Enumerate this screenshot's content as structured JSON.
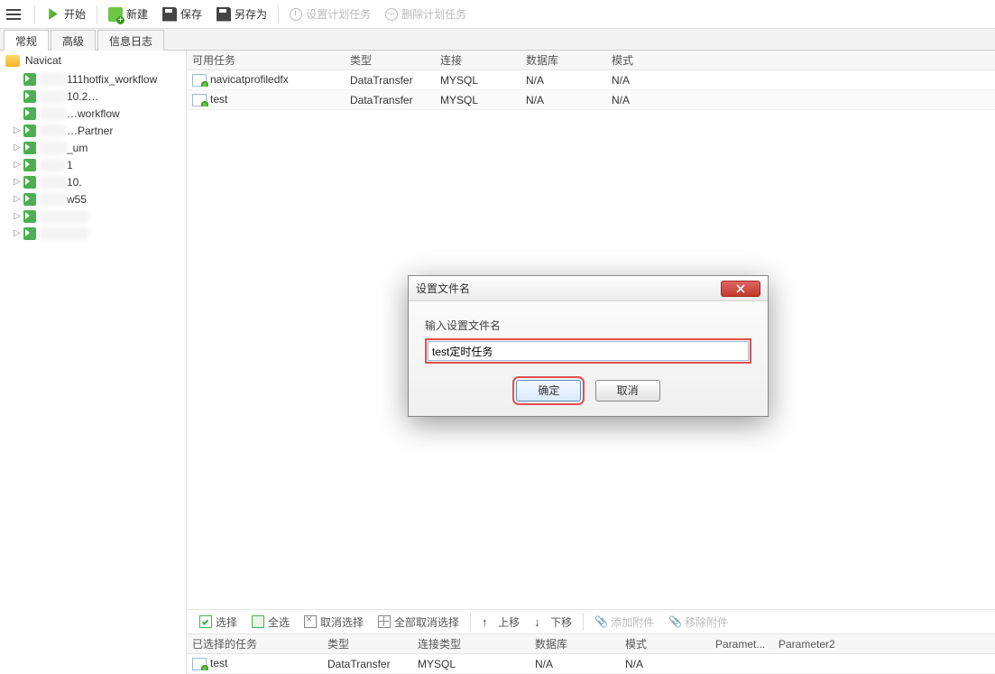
{
  "toolbar": {
    "start": "开始",
    "new": "新建",
    "save": "保存",
    "save_as": "另存为",
    "set_schedule": "设置计划任务",
    "delete_schedule": "删除计划任务"
  },
  "tabs": {
    "general": "常规",
    "advanced": "高级",
    "log": "信息日志"
  },
  "sidebar": {
    "root": "Navicat",
    "items": [
      {
        "label": "111hotfix_workflow"
      },
      {
        "label": "10.2…"
      },
      {
        "label": "…workflow"
      },
      {
        "label": "…Partner"
      },
      {
        "label": "_um"
      },
      {
        "label": "1"
      },
      {
        "label": "10."
      },
      {
        "label": "w55"
      },
      {
        "label": ""
      },
      {
        "label": ""
      }
    ]
  },
  "available": {
    "columns": {
      "task": "可用任务",
      "type": "类型",
      "conn": "连接",
      "db": "数据库",
      "mode": "模式"
    },
    "rows": [
      {
        "task": "navicatprofiledfx",
        "type": "DataTransfer",
        "conn": "MYSQL",
        "db": "N/A",
        "mode": "N/A"
      },
      {
        "task": "test",
        "type": "DataTransfer",
        "conn": "MYSQL",
        "db": "N/A",
        "mode": "N/A"
      }
    ]
  },
  "actions": {
    "select": "选择",
    "select_all": "全选",
    "deselect": "取消选择",
    "deselect_all": "全部取消选择",
    "move_up": "上移",
    "move_down": "下移",
    "add_attach": "添加附件",
    "remove_attach": "移除附件"
  },
  "selected": {
    "columns": {
      "task": "已选择的任务",
      "type": "类型",
      "conn": "连接类型",
      "db": "数据库",
      "mode": "模式",
      "p1": "Paramet...",
      "p2": "Parameter2"
    },
    "rows": [
      {
        "task": "test",
        "type": "DataTransfer",
        "conn": "MYSQL",
        "db": "N/A",
        "mode": "N/A",
        "p1": "",
        "p2": ""
      }
    ]
  },
  "dialog": {
    "title": "设置文件名",
    "label": "输入设置文件名",
    "value": "test定时任务",
    "ok": "确定",
    "cancel": "取消"
  }
}
